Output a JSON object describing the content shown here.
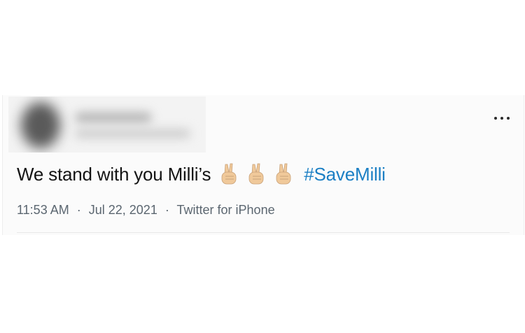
{
  "tweet": {
    "text": "We stand with you Milli’s",
    "emoji_icons": [
      "victory-hand-icon",
      "victory-hand-icon",
      "victory-hand-icon"
    ],
    "hashtag": "#SaveMilli",
    "time": "11:53 AM",
    "separator": "·",
    "date": "Jul 22, 2021",
    "source": "Twitter for iPhone",
    "more_icon": "more-horizontal-icon"
  },
  "colors": {
    "hashtag": "#1b7fc4",
    "text": "#141414",
    "meta": "#5b6670",
    "skin": "#f0c99a"
  }
}
